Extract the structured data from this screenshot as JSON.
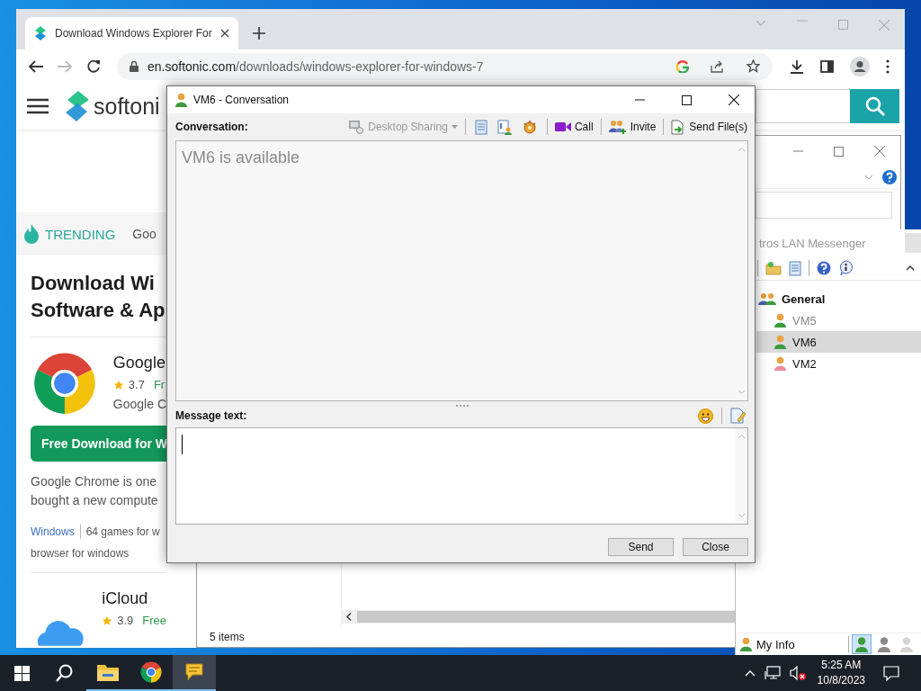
{
  "browser": {
    "tabs": [
      {
        "title": "Download Windows Explorer For",
        "selected": true
      }
    ],
    "url_host": "en.softonic.com",
    "url_path": "/downloads/windows-explorer-for-windows-7"
  },
  "page": {
    "logo": "softoni",
    "trending_label": "TRENDING",
    "trending_items": [
      "Goo"
    ],
    "heading_lines": [
      "Download Wi",
      "Software & Ap"
    ],
    "featured": {
      "name": "Google",
      "rating": "3.7",
      "license": "Fr",
      "publisher": "Google C"
    },
    "download_button": "Free Download for W",
    "description_lines": [
      "Google Chrome is one",
      "bought a new compute"
    ],
    "tags": [
      {
        "kind": "link",
        "label": "Windows"
      },
      {
        "kind": "text",
        "label": "64 games for w"
      }
    ],
    "tags_line2": "browser for windows",
    "next_app": {
      "name": "iCloud",
      "rating": "3.9",
      "license": "Free"
    }
  },
  "explorer": {
    "status": "5 items"
  },
  "messenger": {
    "title": "tros LAN Messenger",
    "groups": [
      {
        "name": "General",
        "children": [
          {
            "name": "VM5",
            "color": "#3c9a3c",
            "dimmed": true,
            "selected": false
          },
          {
            "name": "VM6",
            "color": "#3c9a3c",
            "dimmed": false,
            "selected": true
          },
          {
            "name": "VM2",
            "color": "#ec8e9c",
            "dimmed": false,
            "selected": false
          }
        ]
      }
    ],
    "my_info": "My Info",
    "status_buttons": [
      {
        "color": "#3c9a3c",
        "selected": true
      },
      {
        "color": "#8a8a8a",
        "selected": false
      },
      {
        "color": "#d4d4d4",
        "selected": false
      }
    ]
  },
  "conversation": {
    "title": "VM6 - Conversation",
    "label": "Conversation:",
    "desktop_sharing": {
      "label": "Desktop Sharing",
      "disabled": true
    },
    "actions": [
      "Call",
      "Invite",
      "Send File(s)"
    ],
    "history": [
      "VM6 is available"
    ],
    "message_label": "Message text:",
    "buttons": [
      "Send",
      "Close"
    ]
  },
  "taskbar": {
    "apps": [
      {
        "kind": "folder",
        "selected": false
      },
      {
        "kind": "browser",
        "selected": false
      },
      {
        "kind": "messenger",
        "selected": true
      }
    ],
    "volume_muted": true,
    "time": "5:25 AM",
    "date": "10/8/2023"
  }
}
